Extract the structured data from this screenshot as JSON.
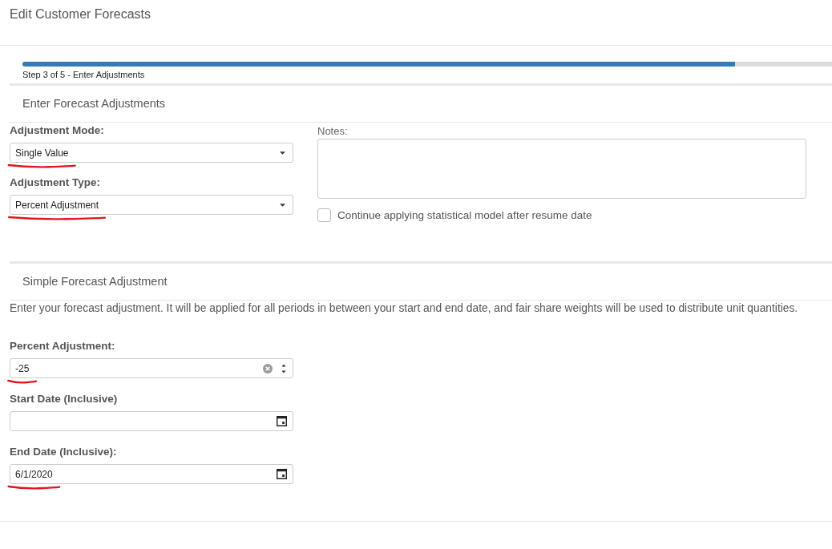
{
  "page": {
    "title": "Edit Customer Forecasts"
  },
  "wizard": {
    "level": 0.88,
    "step_label": "Step 3 of 5 - Enter Adjustments"
  },
  "adjustments_section": {
    "heading": "Enter Forecast Adjustments",
    "fields": [
      {
        "kind": "select",
        "label": "Adjustment Mode:",
        "value": "Single Value",
        "annotated": true
      },
      {
        "kind": "select",
        "label": "Adjustment Type:",
        "value": "Percent Adjustment",
        "annotated": true
      }
    ],
    "notes": {
      "label": "Notes:"
    },
    "continue_model": {
      "label": "Continue applying statistical model after resume date",
      "checked": false
    }
  },
  "simple_section": {
    "heading": "Simple Forecast Adjustment",
    "description": "Enter your forecast adjustment. It will be applied for all periods in between your start and end date, and fair share weights will be used to distribute unit quantities.",
    "fields": [
      {
        "kind": "number",
        "label": "Percent Adjustment:",
        "value": "-25",
        "annotated": true
      },
      {
        "kind": "date",
        "label": "Start Date (Inclusive)",
        "annotated": false
      },
      {
        "kind": "date",
        "label": "End Date (Inclusive):",
        "value": "6/1/2020",
        "annotated": true
      }
    ]
  }
}
